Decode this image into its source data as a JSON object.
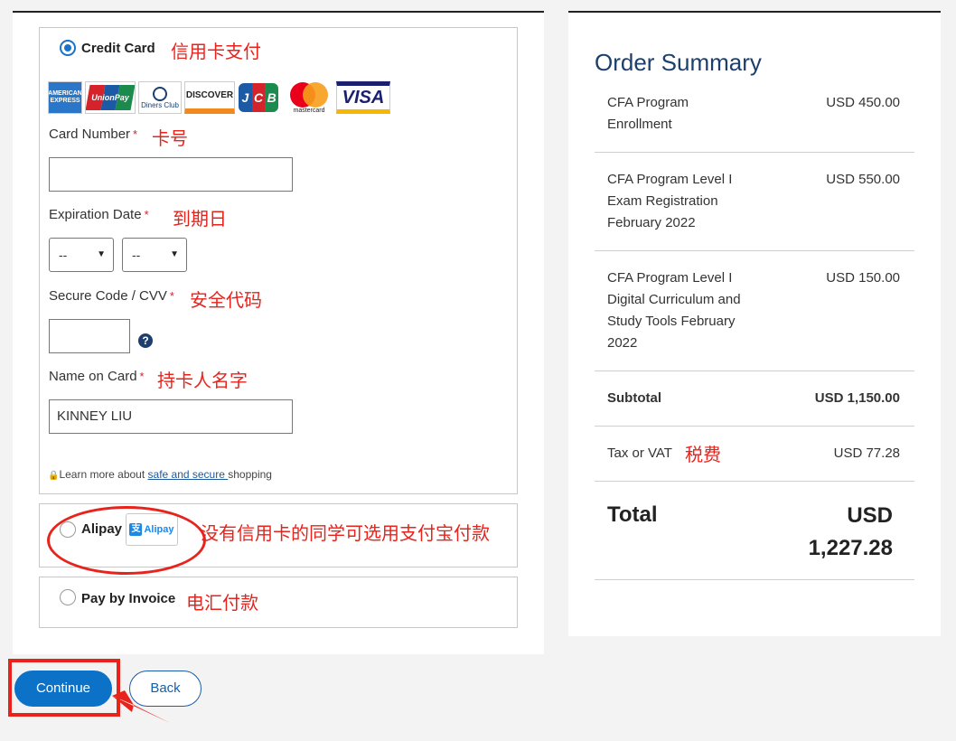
{
  "payment": {
    "credit_card": {
      "label": "Credit Card",
      "note_cn": "信用卡支付",
      "card_logos": [
        "AMERICAN EXPRESS",
        "UnionPay",
        "Diners Club",
        "DISCOVER",
        "JCB",
        "mastercard",
        "VISA"
      ],
      "card_number": {
        "label": "Card Number",
        "note_cn": "卡号",
        "value": ""
      },
      "expiration": {
        "label": "Expiration Date",
        "note_cn": "到期日",
        "month": "--",
        "year": "--"
      },
      "cvv": {
        "label": "Secure Code / CVV",
        "note_cn": "安全代码",
        "value": ""
      },
      "name_on_card": {
        "label": "Name on Card",
        "note_cn": "持卡人名字",
        "value": "KINNEY LIU"
      },
      "required_mark": "*",
      "learn_prefix": "Learn more about ",
      "learn_link": "safe and secure ",
      "learn_suffix": "shopping"
    },
    "alipay": {
      "label": "Alipay",
      "logo_text": "Alipay",
      "note_cn": "没有信用卡的同学可选用支付宝付款"
    },
    "invoice": {
      "label": "Pay by Invoice",
      "note_cn": "电汇付款"
    }
  },
  "summary": {
    "title": "Order Summary",
    "items": [
      {
        "name_lines": [
          "CFA Program",
          "Enrollment"
        ],
        "price": "USD 450.00"
      },
      {
        "name_lines": [
          "CFA Program Level I",
          "Exam Registration",
          "February 2022"
        ],
        "price": "USD 550.00"
      },
      {
        "name_lines": [
          "CFA Program Level I",
          "Digital Curriculum and",
          "Study Tools February",
          "2022"
        ],
        "price": "USD 150.00"
      }
    ],
    "subtotal_label": "Subtotal",
    "subtotal_value": "USD 1,150.00",
    "tax_label": "Tax or VAT",
    "tax_note_cn": "税费",
    "tax_value": "USD 77.28",
    "total_label": "Total",
    "total_currency": "USD",
    "total_value": "1,227.28"
  },
  "buttons": {
    "continue": "Continue",
    "back": "Back"
  },
  "colors": {
    "accent": "#0b72c7",
    "annotation": "#e8231c",
    "title": "#1c3f6e"
  }
}
